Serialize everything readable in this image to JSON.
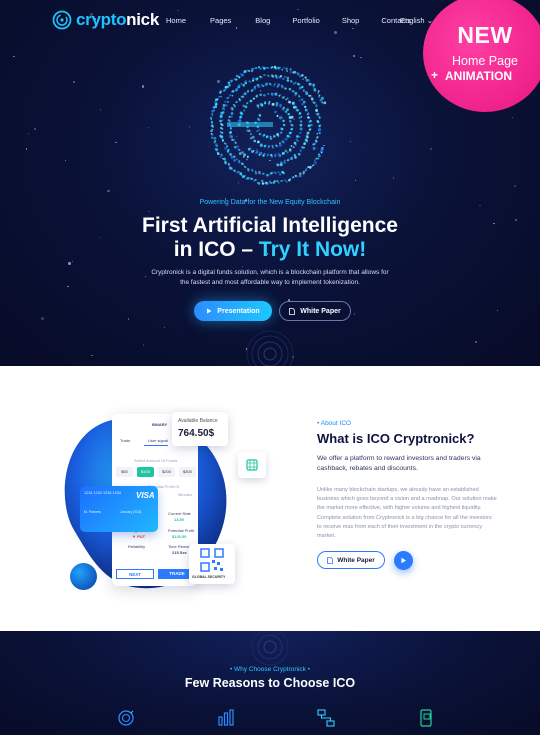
{
  "nav": {
    "logo_part1": "crypto",
    "logo_part2": "nick",
    "items": [
      "Home",
      "Pages",
      "Blog",
      "Portfolio",
      "Shop",
      "Contacts"
    ],
    "language": "English"
  },
  "badge": {
    "new": "NEW",
    "home_page": "Home Page",
    "plus": "+",
    "animation": "ANIMATION"
  },
  "hero": {
    "tagline": "Powering Data for the New Equity Blockchain",
    "title_line1": "First Artificial Intelligence",
    "title_line2_prefix": "in ICO – ",
    "title_line2_highlight": "Try It Now!",
    "subtitle": "Cryptronick is a digital funds solution, which is a blockchain platform that allows for the fastest and most affordable way to implement tokenization.",
    "btn_presentation": "Presentation",
    "btn_whitepaper": "White Paper"
  },
  "about": {
    "kicker": "About ICO",
    "title": "What is ICO Cryptronick?",
    "lead": "We offer a platform to reward investors and traders via cashback, rebates and discounts.",
    "body": "Unlike many blockchain startups, we already have an established business which goes beyond a vision and a roadmap. Our solution make the market more effective, with higher volume and highest liquidity. Complete solution from Cryptronick is a big chance for all the investors to receive max from each of their investment in the crypto currency market.",
    "btn_whitepaper": "White Paper"
  },
  "mockup": {
    "balance_label": "Available Balance",
    "balance_value": "764.50$",
    "binary": "BINARY",
    "tab_trade": "Trade",
    "tab_usersignal": "User signal",
    "select_amount": "Select Amount Of Funds",
    "amounts": [
      "$50",
      "$100",
      "$200",
      "$300"
    ],
    "active_amount": "$100",
    "potential_label": "Potential Profit Of",
    "minutes": "Minutes",
    "card_number": "1234 1234 1234 1234",
    "card_brand": "VISA",
    "card_holder": "M. Parkers",
    "card_date": "January 2018",
    "current_rate_label": "Current Rate",
    "current_rate_value": "13.50",
    "type_label": "Type",
    "type_value": "PUT",
    "potential_profit_label": "Potential Profit",
    "potential_profit_value": "$120.50",
    "reliability_label": "Reliability",
    "time_remain_label": "Time Remain",
    "time_remain_value": "215 Sec",
    "next": "NEXT",
    "trade": "TRADE",
    "global_security": "GLOBAL SECURITY"
  },
  "reasons": {
    "kicker": "Why Choose Cryptronick",
    "title": "Few Reasons to Choose ICO",
    "icons": [
      "coin-cycle-icon",
      "bar-chart-icon",
      "network-icon",
      "mobile-wallet-icon"
    ]
  },
  "colors": {
    "accent": "#2fc4ff",
    "brand_blue": "#2c7bff",
    "badge_pink": "#f0208c",
    "dark_bg": "#0a1238"
  }
}
